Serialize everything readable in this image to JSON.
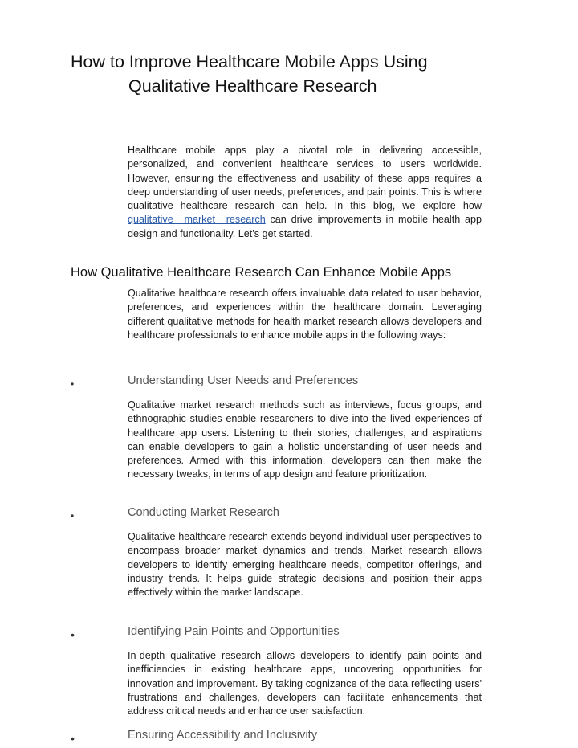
{
  "title": {
    "line1": "How to Improve Healthcare Mobile Apps Using",
    "line2": "Qualitative Healthcare Research"
  },
  "intro": {
    "before_link": "Healthcare mobile apps play a pivotal role in delivering accessible, personalized, and convenient healthcare services to users worldwide. However, ensuring the effectiveness and usability of these apps requires a deep understanding of user needs, preferences, and pain points. This is where qualitative healthcare research can help. In this blog, we explore how ",
    "link_text": "qualitative market research",
    "after_link": " can drive improvements in mobile health app design and functionality. Let’s get started."
  },
  "section": {
    "heading": "How Qualitative Healthcare Research Can Enhance Mobile Apps",
    "body": "Qualitative healthcare research offers invaluable data related to user behavior, preferences, and experiences within the healthcare domain. Leveraging different qualitative methods for health market research allows developers and healthcare professionals to enhance mobile apps in the following ways:"
  },
  "items": [
    {
      "bullet": "•",
      "heading": "Understanding User Needs and Preferences",
      "body": "Qualitative market research methods such as interviews, focus groups, and ethnographic studies enable researchers to dive into the lived experiences of healthcare app users. Listening to their stories, challenges, and aspirations can enable developers to gain a holistic understanding of user needs and preferences. Armed with this information, developers can then make the necessary tweaks, in terms of app design and feature prioritization."
    },
    {
      "bullet": "•",
      "heading": "Conducting Market Research",
      "body": "Qualitative healthcare research extends beyond individual user perspectives to encompass broader market dynamics and trends. Market research allows developers to identify emerging healthcare needs, competitor offerings, and industry trends. It helps guide strategic decisions and position their apps effectively within the market landscape."
    },
    {
      "bullet": "•",
      "heading": "Identifying Pain Points and Opportunities",
      "body": "In-depth qualitative research allows developers to identify pain points and inefficiencies in existing healthcare apps, uncovering opportunities for innovation and improvement. By taking cognizance of the data reflecting users' frustrations and challenges, developers can facilitate enhancements that address critical needs and enhance user satisfaction."
    },
    {
      "bullet": "•",
      "heading": "Ensuring Accessibility and Inclusivity"
    }
  ],
  "colors": {
    "link": "#2a5aa8",
    "subheading": "#555555",
    "text": "#1c1c1c"
  }
}
